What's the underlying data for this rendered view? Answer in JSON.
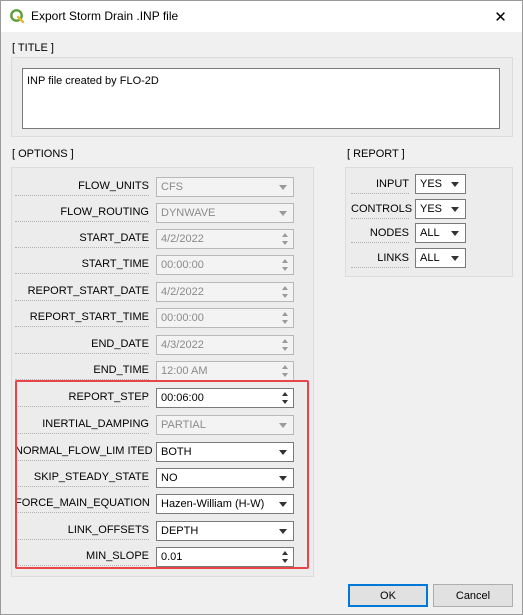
{
  "window": {
    "title": "Export Storm Drain .INP file",
    "close_glyph": "✕"
  },
  "title_section": {
    "label": "[ TITLE ]",
    "value": "INP file created by FLO-2D"
  },
  "options": {
    "label": "[ OPTIONS ]",
    "rows": [
      {
        "label": "FLOW_UNITS",
        "value": "CFS",
        "kind": "combo",
        "enabled": false
      },
      {
        "label": "FLOW_ROUTING",
        "value": "DYNWAVE",
        "kind": "combo",
        "enabled": false
      },
      {
        "label": "START_DATE",
        "value": "4/2/2022",
        "kind": "spin",
        "enabled": false
      },
      {
        "label": "START_TIME",
        "value": "00:00:00",
        "kind": "spin",
        "enabled": false
      },
      {
        "label": "REPORT_START_DATE",
        "value": "4/2/2022",
        "kind": "spin",
        "enabled": false
      },
      {
        "label": "REPORT_START_TIME",
        "value": "00:00:00",
        "kind": "spin",
        "enabled": false
      },
      {
        "label": "END_DATE",
        "value": "4/3/2022",
        "kind": "spin",
        "enabled": false
      },
      {
        "label": "END_TIME",
        "value": "12:00 AM",
        "kind": "spin",
        "enabled": false
      },
      {
        "label": "REPORT_STEP",
        "value": "00:06:00",
        "kind": "spin",
        "enabled": true
      },
      {
        "label": "INERTIAL_DAMPING",
        "value": "PARTIAL",
        "kind": "combo",
        "enabled": false
      },
      {
        "label": "NORMAL_FLOW_LIM ITED",
        "value": "BOTH",
        "kind": "combo",
        "enabled": true
      },
      {
        "label": "SKIP_STEADY_STATE",
        "value": "NO",
        "kind": "combo",
        "enabled": true
      },
      {
        "label": "FORCE_MAIN_EQUATION",
        "value": "Hazen-William (H-W)",
        "kind": "combo",
        "enabled": true
      },
      {
        "label": "LINK_OFFSETS",
        "value": "DEPTH",
        "kind": "combo",
        "enabled": true
      },
      {
        "label": "MIN_SLOPE",
        "value": "0.01",
        "kind": "spin",
        "enabled": true
      }
    ]
  },
  "report": {
    "label": "[ REPORT ]",
    "rows": [
      {
        "label": "INPUT",
        "value": "YES"
      },
      {
        "label": "CONTROLS",
        "value": "YES"
      },
      {
        "label": "NODES",
        "value": "ALL"
      },
      {
        "label": "LINKS",
        "value": "ALL"
      }
    ]
  },
  "buttons": {
    "ok": "OK",
    "cancel": "Cancel"
  },
  "colors": {
    "highlight": "#e8444a",
    "default_button_border": "#0078d7"
  },
  "icons": {
    "app": "qgis-logo-icon",
    "close": "close-icon"
  }
}
